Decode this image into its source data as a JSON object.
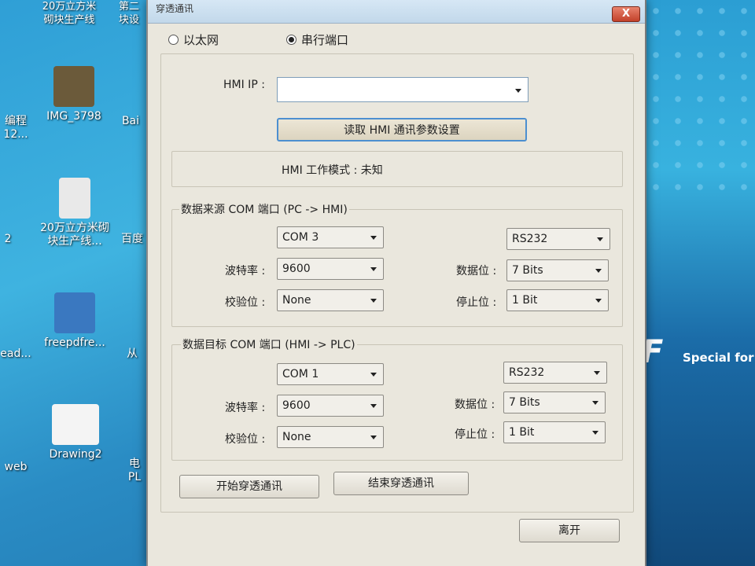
{
  "desktop": {
    "icons": [
      {
        "label": "IMG_3798",
        "color": "#6b5a3a"
      },
      {
        "label": "20万立方米砌块生产线...",
        "color": "#e9e9e9"
      },
      {
        "label": "freepdfre...",
        "color": "#3a78c0"
      },
      {
        "label": "Drawing2",
        "color": "#f4f4f4"
      }
    ],
    "clipped_labels": [
      "编程",
      "12...",
      "Bai",
      "2",
      "百度",
      "ead...",
      "从",
      "web",
      "电",
      "PL",
      "砌块生产线",
      "第二",
      "块设",
      "20万立方米"
    ],
    "brand_text": "Special for",
    "brand_glyph": "F"
  },
  "dialog": {
    "title": "穿透通讯",
    "close_label": "X",
    "mode": {
      "ethernet_label": "以太网",
      "serial_label": "串行端口",
      "selected": "serial"
    },
    "hmi_ip_label": "HMI IP :",
    "hmi_ip_value": "",
    "read_button": "读取 HMI 通讯参数设置",
    "work_mode_label": "HMI 工作模式 : 未知",
    "source_section": {
      "title": "数据来源 COM 端口 (PC -> HMI)",
      "port": "COM 3",
      "interface": "RS232",
      "baud_label": "波特率 :",
      "baud": "9600",
      "databits_label": "数据位 :",
      "databits": "7 Bits",
      "parity_label": "校验位 :",
      "parity": "None",
      "stopbits_label": "停止位 :",
      "stopbits": "1 Bit"
    },
    "target_section": {
      "title": "数据目标 COM 端口 (HMI -> PLC)",
      "port": "COM 1",
      "interface": "RS232",
      "baud_label": "波特率 :",
      "baud": "9600",
      "databits_label": "数据位 :",
      "databits": "7 Bits",
      "parity_label": "校验位 :",
      "parity": "None",
      "stopbits_label": "停止位 :",
      "stopbits": "1 Bit"
    },
    "start_button": "开始穿透通讯",
    "stop_button": "结束穿透通讯",
    "exit_button": "离开"
  }
}
